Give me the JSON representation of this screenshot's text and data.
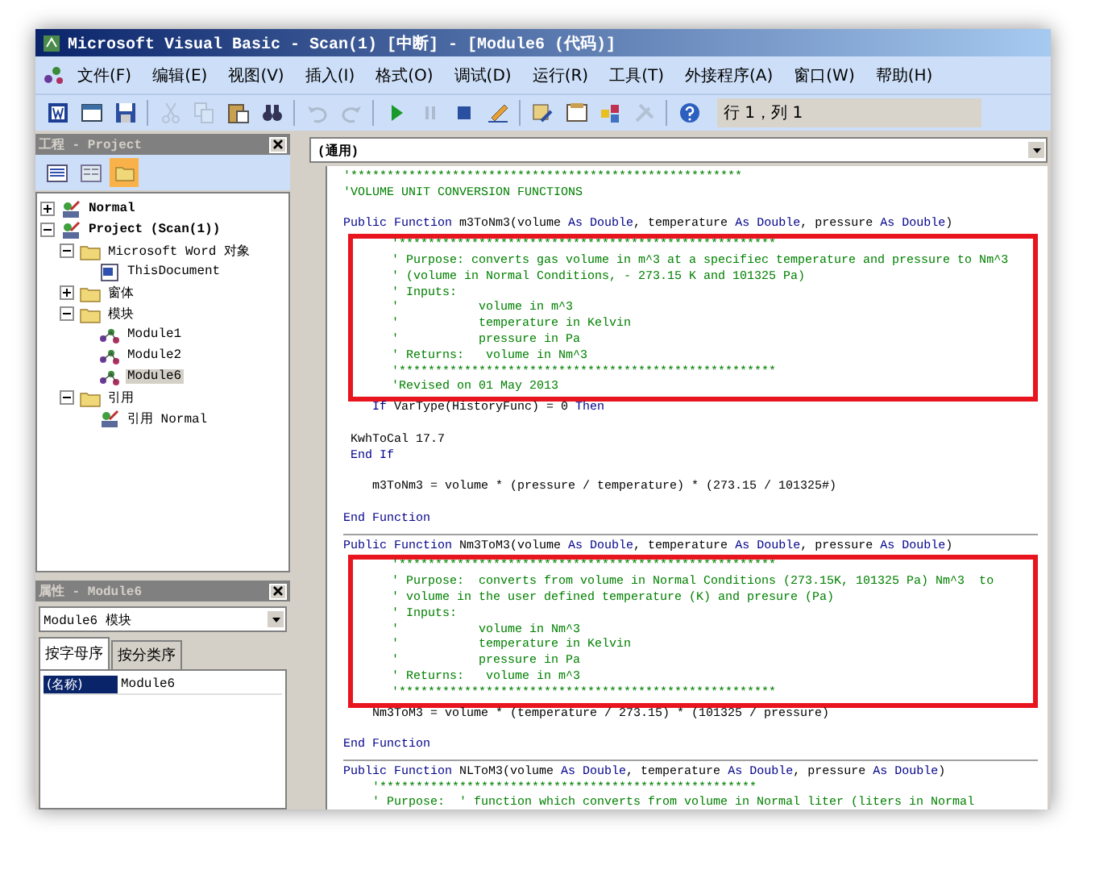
{
  "window": {
    "title": "Microsoft Visual Basic - Scan(1) [中断] - [Module6 (代码)]"
  },
  "menu": [
    "文件(F)",
    "编辑(E)",
    "视图(V)",
    "插入(I)",
    "格式(O)",
    "调试(D)",
    "运行(R)",
    "工具(T)",
    "外接程序(A)",
    "窗口(W)",
    "帮助(H)"
  ],
  "toolbar": {
    "buttons": [
      {
        "kind": "word",
        "disabled": false
      },
      {
        "kind": "form",
        "disabled": false
      },
      {
        "kind": "save",
        "disabled": false
      },
      {
        "kind": "separator"
      },
      {
        "kind": "cut",
        "disabled": true
      },
      {
        "kind": "copy",
        "disabled": true
      },
      {
        "kind": "paste",
        "disabled": false
      },
      {
        "kind": "find",
        "disabled": false
      },
      {
        "kind": "separator"
      },
      {
        "kind": "undo",
        "disabled": true
      },
      {
        "kind": "redo",
        "disabled": true
      },
      {
        "kind": "separator"
      },
      {
        "kind": "run",
        "disabled": false
      },
      {
        "kind": "pause",
        "disabled": true
      },
      {
        "kind": "stop",
        "disabled": false
      },
      {
        "kind": "design",
        "disabled": false
      },
      {
        "kind": "separator"
      },
      {
        "kind": "explorer",
        "disabled": false
      },
      {
        "kind": "properties",
        "disabled": false
      },
      {
        "kind": "browser",
        "disabled": false
      },
      {
        "kind": "toolbox",
        "disabled": true
      },
      {
        "kind": "separator"
      },
      {
        "kind": "help",
        "disabled": false
      }
    ],
    "position": "行 1，列 1"
  },
  "project": {
    "title": "工程 - Project",
    "view_buttons": [
      {
        "kind": "code",
        "selected": false
      },
      {
        "kind": "object",
        "selected": false
      },
      {
        "kind": "folders",
        "selected": true
      }
    ],
    "tree": [
      {
        "label": "Normal",
        "kind": "project",
        "expanded": false,
        "selected": false
      },
      {
        "label": "Project (Scan(1))",
        "kind": "project",
        "expanded": true,
        "selected": false,
        "children": [
          {
            "label": "Microsoft Word 对象",
            "kind": "folder",
            "expanded": true,
            "selected": false,
            "children": [
              {
                "label": "ThisDocument",
                "kind": "document",
                "selected": false
              }
            ]
          },
          {
            "label": "窗体",
            "kind": "folder",
            "expanded": false,
            "selected": false
          },
          {
            "label": "模块",
            "kind": "folder",
            "expanded": true,
            "selected": false,
            "children": [
              {
                "label": "Module1",
                "kind": "module",
                "selected": false
              },
              {
                "label": "Module2",
                "kind": "module",
                "selected": false
              },
              {
                "label": "Module6",
                "kind": "module",
                "selected": true
              }
            ]
          },
          {
            "label": "引用",
            "kind": "folder",
            "expanded": true,
            "selected": false,
            "children": [
              {
                "label": "引用 Normal",
                "kind": "reference",
                "selected": false
              }
            ]
          }
        ]
      }
    ]
  },
  "properties": {
    "title": "属性 - Module6",
    "object": "Module6 模块",
    "tabs": [
      {
        "label": "按字母序",
        "selected": true
      },
      {
        "label": "按分类序",
        "selected": false
      }
    ],
    "rows": [
      {
        "name": "(名称)",
        "value": "Module6",
        "selected": true
      }
    ]
  },
  "code": {
    "scope": "(通用)",
    "procedures": [
      {
        "lines": [
          {
            "kind": "code",
            "segments": [
              {
                "text": "'******************************************************",
                "kind": "comment"
              }
            ]
          },
          {
            "kind": "code",
            "segments": [
              {
                "text": "'VOLUME UNIT CONVERSION FUNCTIONS",
                "kind": "comment"
              }
            ]
          },
          {
            "kind": "blank"
          },
          {
            "kind": "code",
            "segments": [
              {
                "text": "Public Function",
                "kind": "keyword"
              },
              {
                "text": " m3ToNm3(volume ",
                "kind": "plain"
              },
              {
                "text": "As Double",
                "kind": "keyword"
              },
              {
                "text": ", temperature ",
                "kind": "plain"
              },
              {
                "text": "As Double",
                "kind": "keyword"
              },
              {
                "text": ", pressure ",
                "kind": "plain"
              },
              {
                "text": "As Double",
                "kind": "keyword"
              },
              {
                "text": ")",
                "kind": "plain"
              }
            ]
          },
          {
            "kind": "highlight",
            "lines": [
              {
                "kind": "code",
                "segments": [
                  {
                    "text": "    '****************************************************",
                    "kind": "comment"
                  }
                ]
              },
              {
                "kind": "code",
                "segments": [
                  {
                    "text": "    ' Purpose: converts gas volume in m^3 at a specifiec temperature and pressure to Nm^3",
                    "kind": "comment"
                  }
                ]
              },
              {
                "kind": "code",
                "segments": [
                  {
                    "text": "    ' (volume in Normal Conditions, - 273.15 K and 101325 Pa)",
                    "kind": "comment"
                  }
                ]
              },
              {
                "kind": "code",
                "segments": [
                  {
                    "text": "    ' Inputs:",
                    "kind": "comment"
                  }
                ]
              },
              {
                "kind": "code",
                "segments": [
                  {
                    "text": "    '           volume in m^3",
                    "kind": "comment"
                  }
                ]
              },
              {
                "kind": "code",
                "segments": [
                  {
                    "text": "    '           temperature in Kelvin",
                    "kind": "comment"
                  }
                ]
              },
              {
                "kind": "code",
                "segments": [
                  {
                    "text": "    '           pressure in Pa",
                    "kind": "comment"
                  }
                ]
              },
              {
                "kind": "code",
                "segments": [
                  {
                    "text": "    ' Returns:   volume in Nm^3",
                    "kind": "comment"
                  }
                ]
              },
              {
                "kind": "code",
                "segments": [
                  {
                    "text": "    '****************************************************",
                    "kind": "comment"
                  }
                ]
              },
              {
                "kind": "code",
                "segments": [
                  {
                    "text": "    'Revised on 01 May 2013",
                    "kind": "comment"
                  }
                ]
              }
            ]
          },
          {
            "kind": "code",
            "segments": [
              {
                "text": "    If",
                "kind": "keyword"
              },
              {
                "text": " VarType(HistoryFunc) = 0 ",
                "kind": "plain"
              },
              {
                "text": "Then",
                "kind": "keyword"
              }
            ]
          },
          {
            "kind": "blank"
          },
          {
            "kind": "code",
            "segments": [
              {
                "text": " KwhToCal 17.7",
                "kind": "plain"
              }
            ]
          },
          {
            "kind": "code",
            "segments": [
              {
                "text": " End If",
                "kind": "keyword"
              }
            ]
          },
          {
            "kind": "blank"
          },
          {
            "kind": "code",
            "segments": [
              {
                "text": "    m3ToNm3 = volume * (pressure / temperature) * (273.15 / 101325#)",
                "kind": "plain"
              }
            ]
          },
          {
            "kind": "blank"
          },
          {
            "kind": "code",
            "segments": [
              {
                "text": "End Function",
                "kind": "keyword"
              }
            ]
          }
        ]
      },
      {
        "lines": [
          {
            "kind": "code",
            "segments": [
              {
                "text": "Public Function",
                "kind": "keyword"
              },
              {
                "text": " Nm3ToM3(volume ",
                "kind": "plain"
              },
              {
                "text": "As Double",
                "kind": "keyword"
              },
              {
                "text": ", temperature ",
                "kind": "plain"
              },
              {
                "text": "As Double",
                "kind": "keyword"
              },
              {
                "text": ", pressure ",
                "kind": "plain"
              },
              {
                "text": "As Double",
                "kind": "keyword"
              },
              {
                "text": ")",
                "kind": "plain"
              }
            ]
          },
          {
            "kind": "highlight",
            "lines": [
              {
                "kind": "code",
                "segments": [
                  {
                    "text": "    '****************************************************",
                    "kind": "comment"
                  }
                ]
              },
              {
                "kind": "code",
                "segments": [
                  {
                    "text": "    ' Purpose:  converts from volume in Normal Conditions (273.15K, 101325 Pa) Nm^3  to",
                    "kind": "comment"
                  }
                ]
              },
              {
                "kind": "code",
                "segments": [
                  {
                    "text": "    ' volume in the user defined temperature (K) and presure (Pa)",
                    "kind": "comment"
                  }
                ]
              },
              {
                "kind": "code",
                "segments": [
                  {
                    "text": "    ' Inputs:",
                    "kind": "comment"
                  }
                ]
              },
              {
                "kind": "code",
                "segments": [
                  {
                    "text": "    '           volume in Nm^3",
                    "kind": "comment"
                  }
                ]
              },
              {
                "kind": "code",
                "segments": [
                  {
                    "text": "    '           temperature in Kelvin",
                    "kind": "comment"
                  }
                ]
              },
              {
                "kind": "code",
                "segments": [
                  {
                    "text": "    '           pressure in Pa",
                    "kind": "comment"
                  }
                ]
              },
              {
                "kind": "code",
                "segments": [
                  {
                    "text": "    ' Returns:   volume in m^3",
                    "kind": "comment"
                  }
                ]
              },
              {
                "kind": "code",
                "segments": [
                  {
                    "text": "    '****************************************************",
                    "kind": "comment"
                  }
                ]
              }
            ]
          },
          {
            "kind": "code",
            "segments": [
              {
                "text": "    Nm3ToM3 = volume * (temperature / 273.15) * (101325 / pressure)",
                "kind": "plain"
              }
            ]
          },
          {
            "kind": "blank"
          },
          {
            "kind": "code",
            "segments": [
              {
                "text": "End Function",
                "kind": "keyword"
              }
            ]
          }
        ]
      },
      {
        "lines": [
          {
            "kind": "code",
            "segments": [
              {
                "text": "Public Function",
                "kind": "keyword"
              },
              {
                "text": " NLToM3(volume ",
                "kind": "plain"
              },
              {
                "text": "As Double",
                "kind": "keyword"
              },
              {
                "text": ", temperature ",
                "kind": "plain"
              },
              {
                "text": "As Double",
                "kind": "keyword"
              },
              {
                "text": ", pressure ",
                "kind": "plain"
              },
              {
                "text": "As Double",
                "kind": "keyword"
              },
              {
                "text": ")",
                "kind": "plain"
              }
            ]
          },
          {
            "kind": "code",
            "segments": [
              {
                "text": "    '****************************************************",
                "kind": "comment"
              }
            ]
          },
          {
            "kind": "code",
            "segments": [
              {
                "text": "    ' Purpose:  ' function which converts from volume in Normal liter (liters in Normal",
                "kind": "comment"
              }
            ]
          }
        ]
      }
    ]
  }
}
